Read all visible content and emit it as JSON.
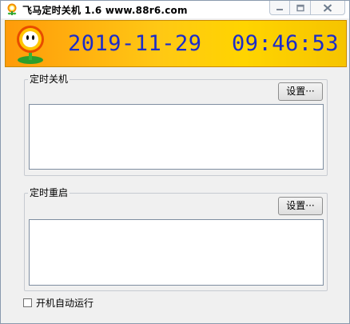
{
  "window": {
    "title": "飞马定时关机 1.6  www.88r6.com"
  },
  "banner": {
    "date": "2019-11-29",
    "time": "09:46:53"
  },
  "shutdown_group": {
    "label": "定时关机",
    "settings_label": "设置···"
  },
  "restart_group": {
    "label": "定时重启",
    "settings_label": "设置···"
  },
  "autostart": {
    "label": "开机自动运行",
    "checked": false
  },
  "colors": {
    "clock_text": "#1b2cc9",
    "banner_left": "#ff9b0a",
    "banner_right": "#ffd400"
  },
  "icons": {
    "app": "flower-icon",
    "minimize": "minimize-icon",
    "maximize": "maximize-icon",
    "close": "close-icon"
  }
}
